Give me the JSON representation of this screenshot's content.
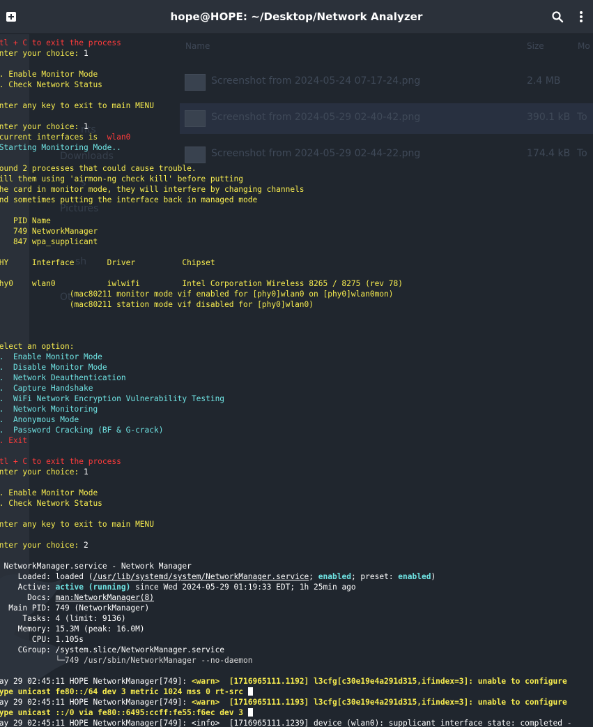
{
  "window": {
    "title": "hope@HOPE: ~/Desktop/Network Analyzer"
  },
  "colors": {
    "yellow": "#f7ec4f",
    "red": "#ff3b3b",
    "cyan": "#6fe3e3",
    "white": "#ffffff",
    "background": "#20262e",
    "titlebar": "#2b313a"
  },
  "icons": [
    "new-tab-icon",
    "search-icon",
    "menu-icon"
  ],
  "ghost": {
    "header_name": "Name",
    "header_size": "Size",
    "header_modified": "Mo",
    "rows": [
      {
        "name": "Screenshot from 2024-05-24 07-17-24.png",
        "size": "2.4 MB",
        "type": ""
      },
      {
        "name": "Screenshot from 2024-05-29 02-40-42.png",
        "size": "390.1 kB",
        "type": "To"
      },
      {
        "name": "Screenshot from 2024-05-29 02-44-22.png",
        "size": "174.4 kB",
        "type": "To"
      }
    ],
    "sidebar": [
      "nts",
      "Downloads",
      "s",
      "Pictures",
      "sh",
      "Ot"
    ]
  },
  "terminal": {
    "lines": [
      [
        {
          "t": "Ctl + C to exit the process",
          "c": "r"
        }
      ],
      [
        {
          "t": "Enter your choice: ",
          "c": "y"
        },
        {
          "t": "1",
          "c": "w"
        }
      ],
      [],
      [
        {
          "t": "1. Enable Monitor Mode",
          "c": "y"
        }
      ],
      [
        {
          "t": "2. Check Network Status",
          "c": "y"
        }
      ],
      [],
      [
        {
          "t": "Enter any key to exit to main MENU",
          "c": "y"
        }
      ],
      [],
      [
        {
          "t": "Enter your choice: ",
          "c": "y"
        },
        {
          "t": "1",
          "c": "w"
        }
      ],
      [
        {
          "t": " current interfaces is  ",
          "c": "y"
        },
        {
          "t": "wlan0",
          "c": "r"
        }
      ],
      [
        {
          "t": " Starting Monitoring Mode..",
          "c": "c"
        }
      ],
      [],
      [
        {
          "t": "Found 2 processes that could cause trouble.",
          "c": "y"
        }
      ],
      [
        {
          "t": "Kill them using 'airmon-ng check kill' before putting",
          "c": "y"
        }
      ],
      [
        {
          "t": "the card in monitor mode, they will interfere by changing channels",
          "c": "y"
        }
      ],
      [
        {
          "t": "and sometimes putting the interface back in managed mode",
          "c": "y"
        }
      ],
      [],
      [
        {
          "t": "    PID Name",
          "c": "y"
        }
      ],
      [
        {
          "t": "    749 NetworkManager",
          "c": "y"
        }
      ],
      [
        {
          "t": "    847 wpa_supplicant",
          "c": "y"
        }
      ],
      [],
      [
        {
          "t": "PHY     Interface       Driver          Chipset",
          "c": "y"
        }
      ],
      [],
      [
        {
          "t": "phy0    wlan0           iwlwifi         Intel Corporation Wireless 8265 / 8275 (rev 78)",
          "c": "y"
        }
      ],
      [
        {
          "t": "                (mac80211 monitor mode vif enabled for [phy0]wlan0 on [phy0]wlan0mon)",
          "c": "y"
        }
      ],
      [
        {
          "t": "                (mac80211 station mode vif disabled for [phy0]wlan0)",
          "c": "y"
        }
      ],
      [],
      [],
      [],
      [
        {
          "t": "Select an option:",
          "c": "y"
        }
      ],
      [
        {
          "t": "1.  Enable Monitor Mode",
          "c": "c"
        }
      ],
      [
        {
          "t": "2.  Disable Monitor Mode",
          "c": "c"
        }
      ],
      [
        {
          "t": "3.  Network Deauthentication",
          "c": "c"
        }
      ],
      [
        {
          "t": "4.  Capture Handshake",
          "c": "c"
        }
      ],
      [
        {
          "t": "5.  WiFi Network Encryption Vulnerability Testing",
          "c": "c"
        }
      ],
      [
        {
          "t": "6.  Network Monitoring",
          "c": "c"
        }
      ],
      [
        {
          "t": "7.  Anonymous Mode",
          "c": "c"
        }
      ],
      [
        {
          "t": "8.  Password Cracking (BF & G-crack)",
          "c": "c"
        }
      ],
      [
        {
          "t": "9. Exit",
          "c": "r"
        }
      ],
      [],
      [
        {
          "t": "Ctl + C to exit the process",
          "c": "r"
        }
      ],
      [
        {
          "t": "Enter your choice: ",
          "c": "y"
        },
        {
          "t": "1",
          "c": "w"
        }
      ],
      [],
      [
        {
          "t": "1. Enable Monitor Mode",
          "c": "y"
        }
      ],
      [
        {
          "t": "2. Check Network Status",
          "c": "y"
        }
      ],
      [],
      [
        {
          "t": "Enter any key to exit to main MENU",
          "c": "y"
        }
      ],
      [],
      [
        {
          "t": "Enter your choice: ",
          "c": "y"
        },
        {
          "t": "2",
          "c": "w"
        }
      ],
      [],
      [
        {
          "t": "● NetworkManager.service - Network Manager",
          "c": "w"
        }
      ],
      [
        {
          "t": "     Loaded: loaded (",
          "c": "w"
        },
        {
          "t": "/usr/lib/systemd/system/NetworkManager.service",
          "c": "w",
          "u": true
        },
        {
          "t": "; ",
          "c": "w"
        },
        {
          "t": "enabled",
          "c": "c",
          "b": true
        },
        {
          "t": "; preset: ",
          "c": "w"
        },
        {
          "t": "enabled",
          "c": "c",
          "b": true
        },
        {
          "t": ")",
          "c": "w"
        }
      ],
      [
        {
          "t": "     Active: ",
          "c": "w"
        },
        {
          "t": "active (running)",
          "c": "c",
          "b": true
        },
        {
          "t": " since Wed 2024-05-29 01:19:33 EDT; 1h 25min ago",
          "c": "w"
        }
      ],
      [
        {
          "t": "       Docs: ",
          "c": "w"
        },
        {
          "t": "man:NetworkManager(8)",
          "c": "w",
          "u": true
        }
      ],
      [
        {
          "t": "   Main PID: 749 (NetworkManager)",
          "c": "w"
        }
      ],
      [
        {
          "t": "      Tasks: 4 (limit: 9136)",
          "c": "w"
        }
      ],
      [
        {
          "t": "     Memory: 15.3M (peak: 16.0M)",
          "c": "w"
        }
      ],
      [
        {
          "t": "        CPU: 1.105s",
          "c": "w"
        }
      ],
      [
        {
          "t": "     CGroup: /system.slice/NetworkManager.service",
          "c": "w"
        }
      ],
      [
        {
          "t": "             └─749 /usr/sbin/NetworkManager --no-daemon",
          "c": "g"
        }
      ],
      [],
      [
        {
          "t": "May 29 02:45:11 HOPE NetworkManager[749]: ",
          "c": "w"
        },
        {
          "t": "<warn>  [1716965111.1192] l3cfg[c30e19e4a291d315,ifindex=3]: unable to configure",
          "c": "y",
          "b": true
        }
      ],
      [
        {
          "t": "type unicast fe80::/64 dev 3 metric 1024 mss 0 rt-src ",
          "c": "y",
          "b": true
        },
        {
          "cur": true
        }
      ],
      [
        {
          "t": "May 29 02:45:11 HOPE NetworkManager[749]: ",
          "c": "w"
        },
        {
          "t": "<warn>  [1716965111.1193] l3cfg[c30e19e4a291d315,ifindex=3]: unable to configure",
          "c": "y",
          "b": true
        }
      ],
      [
        {
          "t": "type unicast ::/0 via fe80::6495:ccff:fe55:f6ec dev 3 ",
          "c": "y",
          "b": true
        },
        {
          "cur": true
        }
      ],
      [
        {
          "t": "May 29 02:45:11 HOPE NetworkManager[749]: <info>  [1716965111.1239] device (wlan0): supplicant interface state: completed -",
          "c": "w"
        }
      ]
    ]
  }
}
